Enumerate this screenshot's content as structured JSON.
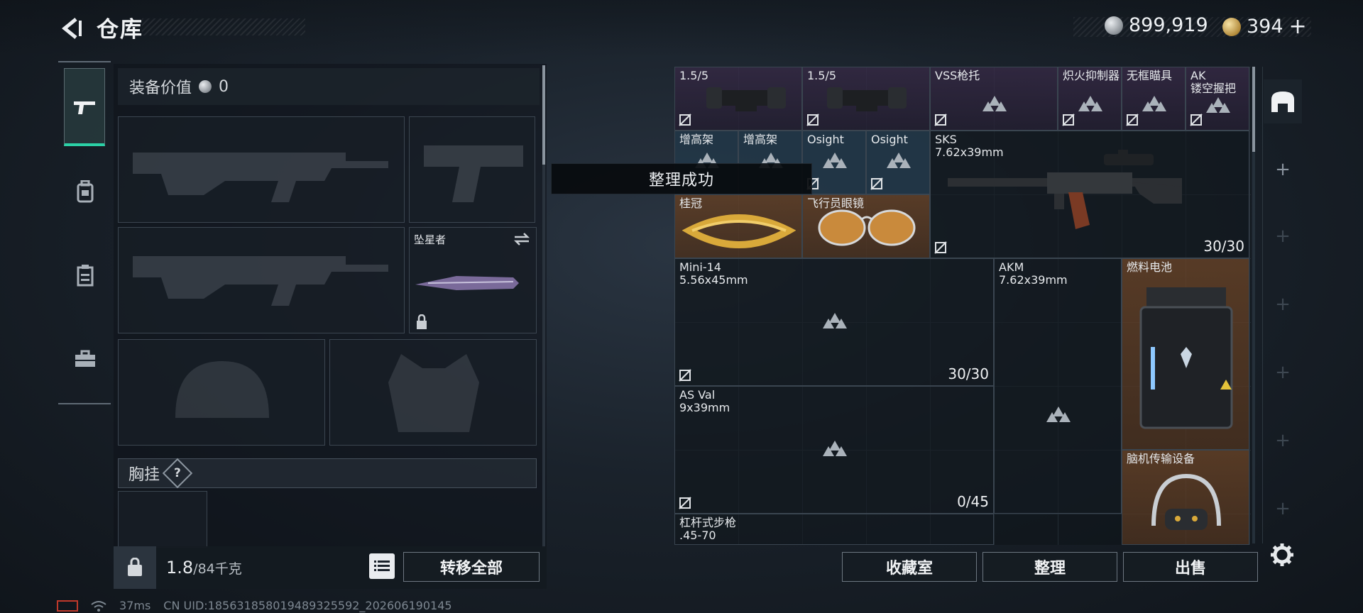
{
  "header": {
    "title": "仓库",
    "currency_silver": "899,919",
    "currency_gold": "394",
    "currency_add": "+"
  },
  "left_panel": {
    "value_label": "装备价值",
    "value_amount": "0",
    "melee_slot_label": "坠星者",
    "chest_rig_label": "胸挂",
    "chest_rig_help": "?",
    "weight_current": "1.8",
    "weight_max": "/84千克",
    "transfer_all_label": "转移全部"
  },
  "toast": "整理成功",
  "items": {
    "scope1_label": "1.5/5",
    "scope2_label": "1.5/5",
    "vss_stock_label": "VSS枪托",
    "suppressor_label": "炽火抑制器",
    "frameless_sight_label": "无框瞄具",
    "ak_grip_label": "AK\n镂空握把",
    "riser1_label": "增高架",
    "riser2_label": "增高架",
    "osight1_label": "Osight",
    "osight2_label": "Osight",
    "sks_label": "SKS\n7.62x39mm",
    "sks_count": "30/30",
    "laurel_label": "桂冠",
    "aviator_label": "飞行员眼镜",
    "mini14_label": "Mini-14\n5.56x45mm",
    "mini14_count": "30/30",
    "akm_label": "AKM\n7.62x39mm",
    "fuel_cell_label": "燃料电池",
    "asval_label": "AS Val\n9x39mm",
    "asval_count": "0/45",
    "neural_device_label": "脑机传输设备",
    "lever_rifle_label": "杠杆式步枪\n.45-70"
  },
  "bottom_buttons": {
    "collection_label": "收藏室",
    "sort_label": "整理",
    "sell_label": "出售"
  },
  "status": {
    "ping": "37ms",
    "uid": "CN UID:18563185801948932559​2_202606190145"
  },
  "colors": {
    "accent_green": "#2bd1a6",
    "rarity_purple": "#3a2c4a",
    "rarity_blue": "#263e50",
    "rarity_orange": "#6e4628"
  }
}
